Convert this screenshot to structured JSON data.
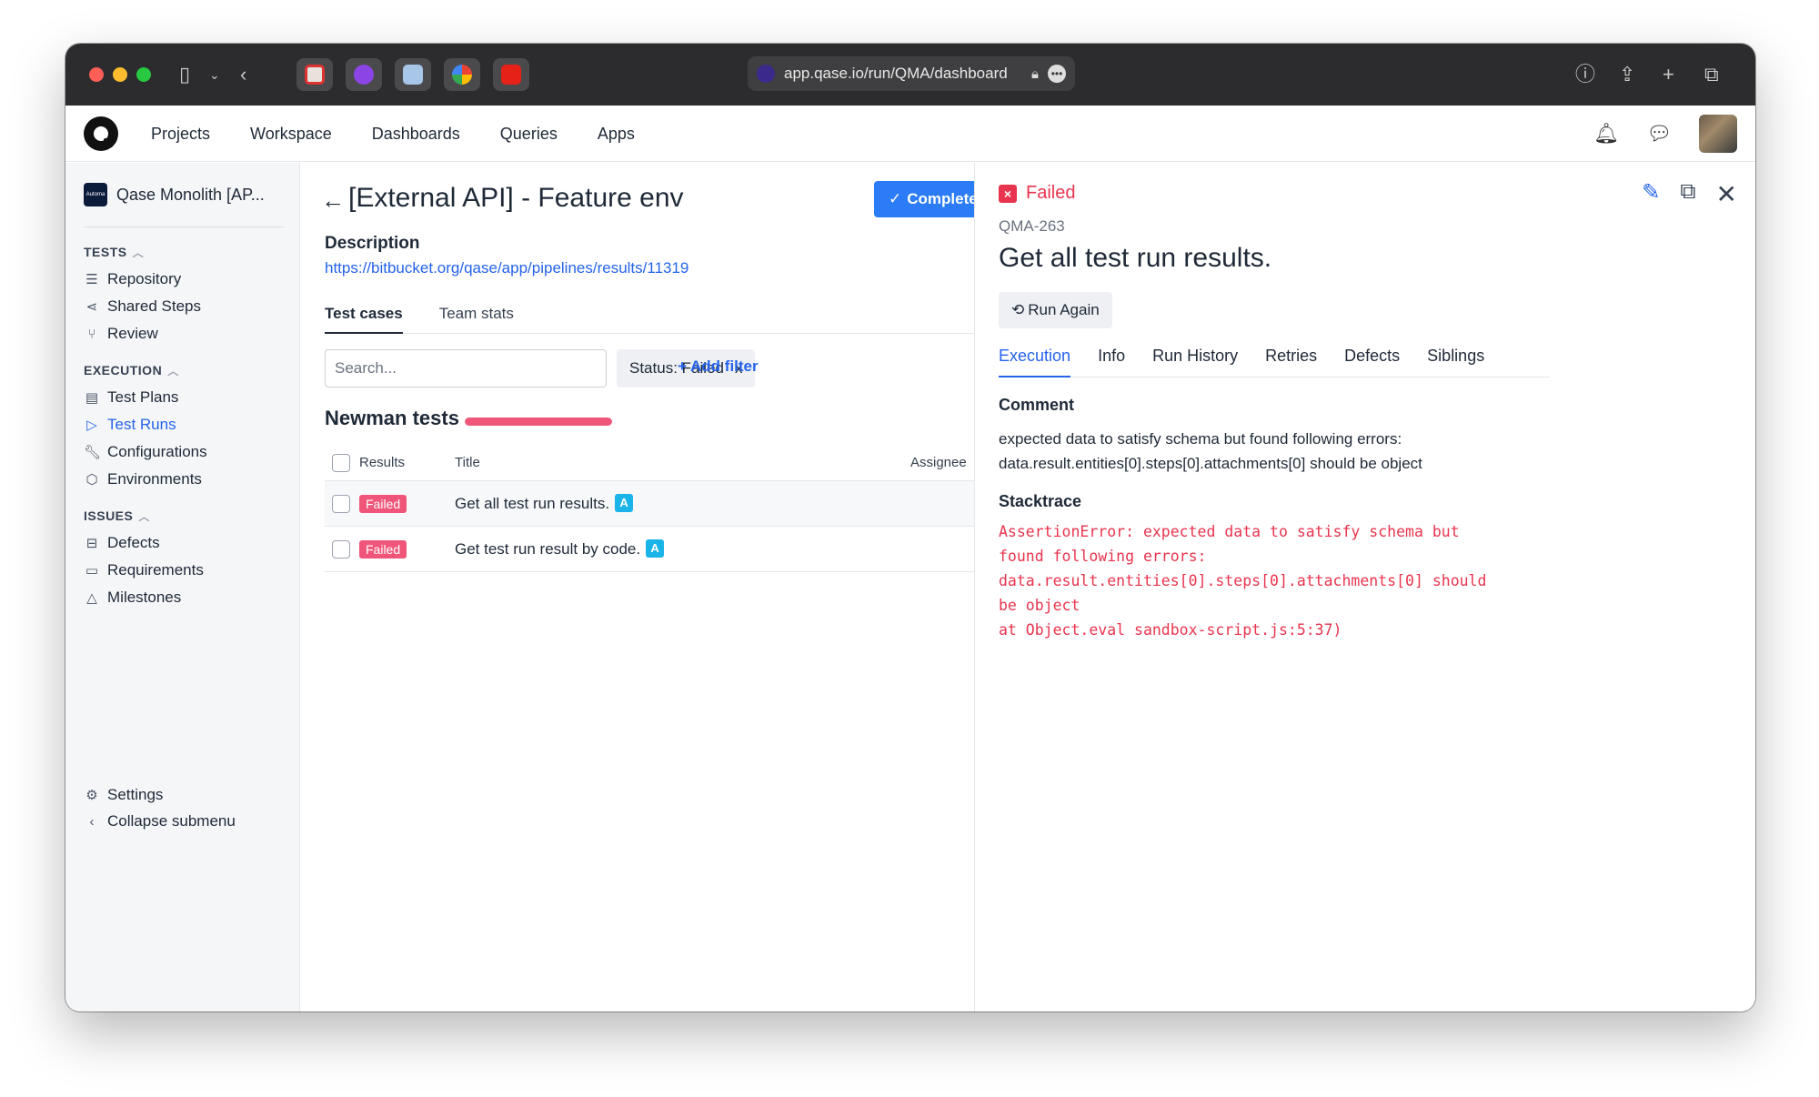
{
  "browser": {
    "url": "app.qase.io/run/QMA/dashboard",
    "favicons": [
      "red-bookmark-icon",
      "purple-bookmark-icon",
      "blue-bookmark-icon",
      "google-icon",
      "youtube-icon"
    ]
  },
  "topnav": {
    "items": [
      "Projects",
      "Workspace",
      "Dashboards",
      "Queries",
      "Apps"
    ]
  },
  "sidebar": {
    "project": "Qase Monolith [AP...",
    "project_icon_text": "Automa",
    "sections": {
      "tests": "TESTS",
      "execution": "EXECUTION",
      "issues": "ISSUES"
    },
    "items": {
      "repository": "Repository",
      "shared_steps": "Shared Steps",
      "review": "Review",
      "test_plans": "Test Plans",
      "test_runs": "Test Runs",
      "configurations": "Configurations",
      "environments": "Environments",
      "defects": "Defects",
      "requirements": "Requirements",
      "milestones": "Milestones",
      "settings": "Settings",
      "collapse": "Collapse submenu"
    }
  },
  "main": {
    "title": "[External API] - Feature env",
    "complete_label": "Complete",
    "description_label": "Description",
    "description_link": "https://bitbucket.org/qase/app/pipelines/results/11319",
    "tabs": [
      "Test cases",
      "Team stats"
    ],
    "search_placeholder": "Search...",
    "status_filter": "Status: Failed",
    "status_filter_remove": "x",
    "add_filter": "+ Add filter",
    "suite_title": "Newman tests",
    "suite_progress_failed": 1.0,
    "columns": {
      "results": "Results",
      "title": "Title",
      "assignee": "Assignee"
    },
    "rows": [
      {
        "status": "Failed",
        "title": "Get all test run results.",
        "badge": "A"
      },
      {
        "status": "Failed",
        "title": "Get test run result by code.",
        "badge": "A"
      }
    ]
  },
  "panel": {
    "status": "Failed",
    "code": "QMA-263",
    "title": "Get all test run results.",
    "run_again": "Run Again",
    "tabs": [
      "Execution",
      "Info",
      "Run History",
      "Retries",
      "Defects",
      "Siblings"
    ],
    "comment_label": "Comment",
    "comment": "expected data to satisfy schema but found following errors: data.result.entities[0].steps[0].attachments[0] should be object",
    "stacktrace_label": "Stacktrace",
    "stacktrace": "AssertionError: expected data to satisfy schema but\nfound following errors:\ndata.result.entities[0].steps[0].attachments[0] should\nbe object\nat Object.eval sandbox-script.js:5:37)"
  },
  "colors": {
    "accent": "#2563eb",
    "complete_button": "#2b7cf6",
    "failed": "#e8344e",
    "failed_badge": "#f0567a",
    "auto_badge": "#1ab4e8"
  }
}
